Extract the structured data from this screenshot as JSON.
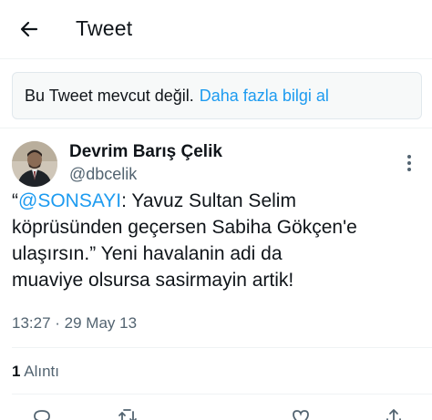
{
  "header": {
    "title": "Tweet",
    "back_icon": "arrow-left-icon"
  },
  "notice": {
    "text": "Bu Tweet mevcut değil.",
    "link": "Daha fazla bilgi al"
  },
  "author": {
    "name": "Devrim Barış Çelik",
    "handle": "@dbcelik",
    "avatar_icon": "user-avatar"
  },
  "tweet": {
    "quote_open": "“",
    "mention": "@SONSAYI",
    "line1_rest": ": Yavuz Sultan Selim",
    "line2": "köprüsünden geçersen Sabiha Gökçen'e",
    "line3": "ulaşırsın.” Yeni havalanin adi da",
    "line4": "muaviye olsursa sasirmayin artik!"
  },
  "meta": {
    "timestamp": "13:27 · 29 May 13"
  },
  "stats": {
    "quote_count": "1",
    "quote_label": "Alıntı"
  },
  "actions": [
    "reply-icon",
    "retweet-icon",
    "like-icon",
    "share-icon"
  ],
  "colors": {
    "accent": "#1d9bf0",
    "secondary_text": "#536471",
    "primary_text": "#0f1419"
  }
}
